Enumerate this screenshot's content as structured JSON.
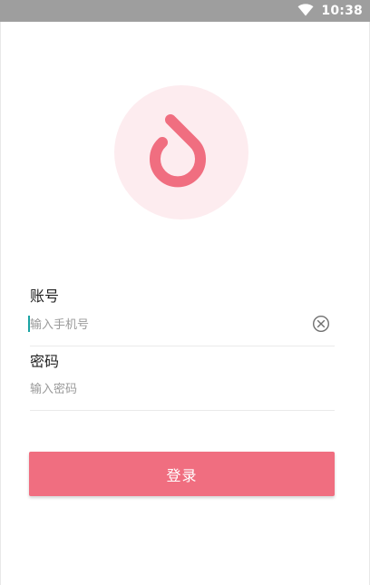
{
  "status_bar": {
    "time": "10:38",
    "wifi_icon": "wifi-icon"
  },
  "colors": {
    "accent": "#f06e80",
    "logo_bg": "#fdecef",
    "status_bar": "#9e9e9e",
    "caret": "#1aa3a3"
  },
  "logo": {
    "icon": "drop-logo-icon"
  },
  "form": {
    "account_label": "账号",
    "account_placeholder": "输入手机号",
    "account_value": "",
    "clear_icon": "clear-icon",
    "password_label": "密码",
    "password_placeholder": "输入密码",
    "password_value": ""
  },
  "login_button": {
    "label": "登录"
  }
}
